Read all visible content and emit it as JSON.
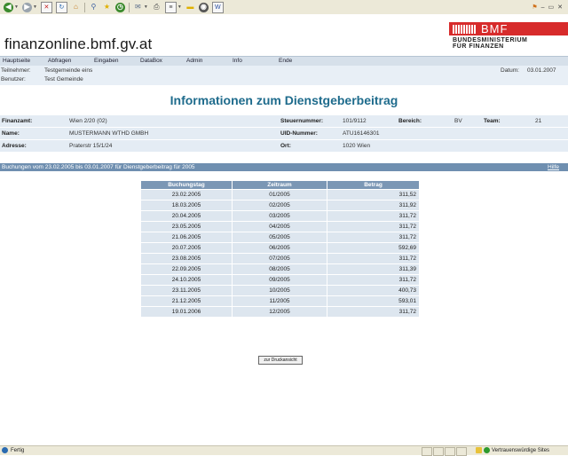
{
  "browser": {
    "toolbar_icons": [
      "back-icon",
      "forward-icon",
      "stop-icon",
      "refresh-icon",
      "home-icon",
      "search-icon",
      "favorites-icon",
      "history-icon",
      "mail-icon",
      "print-icon",
      "edit-icon",
      "folder-icon",
      "media-icon",
      "word-icon"
    ]
  },
  "header": {
    "site_title": "finanzonline.bmf.gv.at",
    "logo_word": "BMF",
    "logo_line1": "BUNDESMINISTERIUM",
    "logo_line2": "FÜR FINANZEN"
  },
  "menu": [
    "Hauptseite",
    "Abfragen",
    "Eingaben",
    "DataBox",
    "Admin",
    "Info",
    "Ende"
  ],
  "info": {
    "teilnehmer_label": "Teilnehmer:",
    "teilnehmer_value": "Testgemeinde eins",
    "benutzer_label": "Benutzer:",
    "benutzer_value": "Test Gemeinde",
    "datum_label": "Datum:",
    "datum_value": "03.01.2007"
  },
  "page_title": "Informationen zum Dienstgeberbeitrag",
  "details": {
    "finanzamt_label": "Finanzamt:",
    "finanzamt_value": "Wien 2/20 (02)",
    "steuernummer_label": "Steuernummer:",
    "steuernummer_value": "101/9112",
    "bereich_label": "Bereich:",
    "bereich_value": "BV",
    "team_label": "Team:",
    "team_value": "21",
    "name_label": "Name:",
    "name_value": "MUSTERMANN WTHD GMBH",
    "uid_label": "UID-Nummer:",
    "uid_value": "ATU16146301",
    "adresse_label": "Adresse:",
    "adresse_value": "Praterstr 15/1/24",
    "ort_label": "Ort:",
    "ort_value": "1020 Wien"
  },
  "section": {
    "title": "Buchungen vom 23.02.2005 bis 03.01.2007 für Dienstgeberbeitrag für 2005",
    "help": "Hilfe"
  },
  "table": {
    "headers": [
      "Buchungstag",
      "Zeitraum",
      "Betrag"
    ],
    "rows": [
      [
        "23.02.2005",
        "01/2005",
        "311,52"
      ],
      [
        "18.03.2005",
        "02/2005",
        "311,92"
      ],
      [
        "20.04.2005",
        "03/2005",
        "311,72"
      ],
      [
        "23.05.2005",
        "04/2005",
        "311,72"
      ],
      [
        "21.06.2005",
        "05/2005",
        "311,72"
      ],
      [
        "20.07.2005",
        "06/2005",
        "592,69"
      ],
      [
        "23.08.2005",
        "07/2005",
        "311,72"
      ],
      [
        "22.09.2005",
        "08/2005",
        "311,39"
      ],
      [
        "24.10.2005",
        "09/2005",
        "311,72"
      ],
      [
        "23.11.2005",
        "10/2005",
        "400,73"
      ],
      [
        "21.12.2005",
        "11/2005",
        "593,01"
      ],
      [
        "19.01.2006",
        "12/2005",
        "311,72"
      ]
    ]
  },
  "print_button": "zur Druckansicht",
  "status": {
    "left": "Fertig",
    "zone": "Vertrauenswürdige Sites"
  },
  "colors": {
    "title": "#1e6b8c",
    "section_bar": "#6f8fb0",
    "table_header": "#7b97b5",
    "row_bg": "#dde6ef",
    "logo_red": "#d72b2b"
  }
}
